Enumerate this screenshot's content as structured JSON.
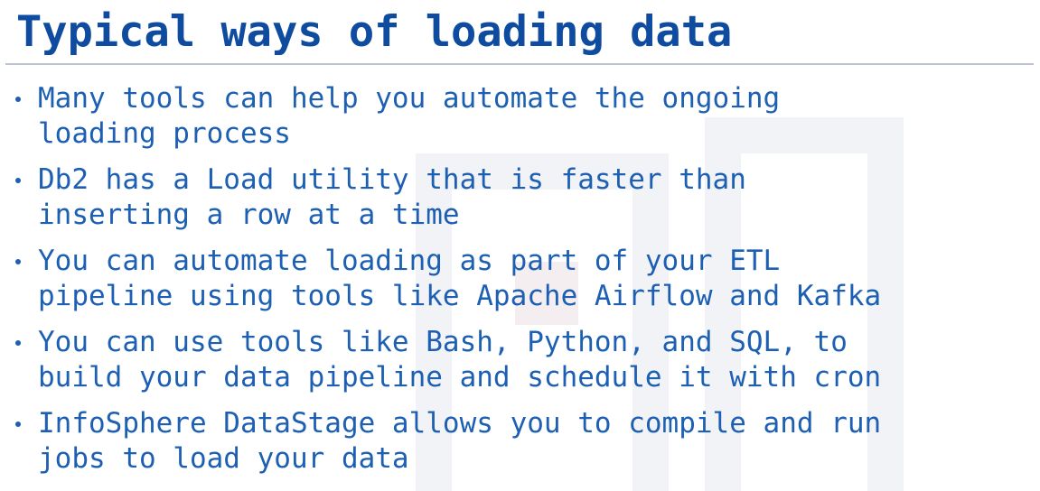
{
  "slide": {
    "title": "Typical ways of loading data",
    "bullets": [
      {
        "lines": [
          "Many tools can help you automate the ongoing",
          "loading process"
        ]
      },
      {
        "lines": [
          "Db2 has a Load utility that is faster than",
          "inserting a row at a time"
        ]
      },
      {
        "lines": [
          "You can automate loading as part of your ETL",
          "pipeline using tools like Apache Airflow and Kafka"
        ]
      },
      {
        "lines": [
          "You can use tools like Bash, Python, and SQL, to",
          "build your data pipeline and schedule it with cron"
        ]
      },
      {
        "lines": [
          "InfoSphere DataStage allows you to compile and run",
          "jobs to load your data"
        ]
      }
    ]
  },
  "colors": {
    "title": "#0f4ca0",
    "body": "#1c5fb3",
    "rule": "#b9c3d2"
  }
}
